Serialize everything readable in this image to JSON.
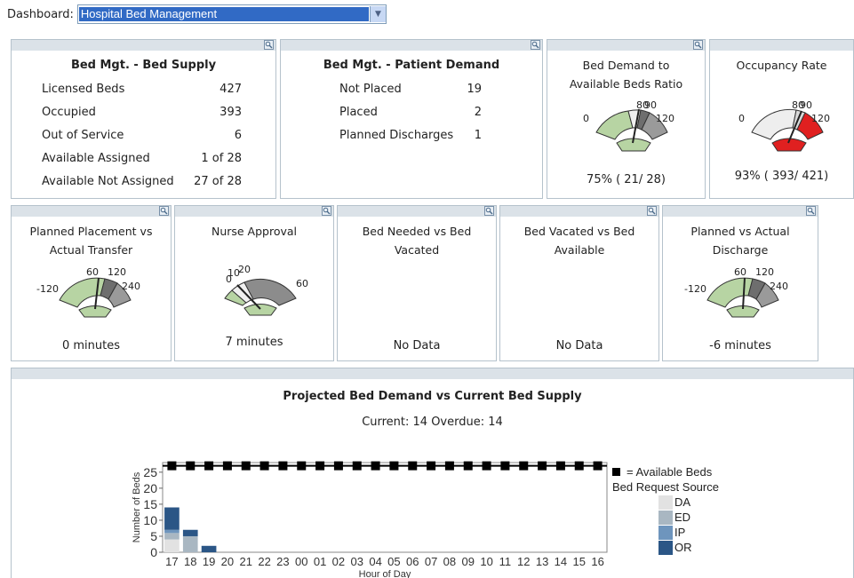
{
  "header": {
    "dashboard_label": "Dashboard:",
    "dashboard_value": "Hospital Bed Management"
  },
  "bed_supply": {
    "title": "Bed Mgt. - Bed Supply",
    "rows": [
      {
        "label": "Licensed Beds",
        "value": "427"
      },
      {
        "label": "Occupied",
        "value": "393"
      },
      {
        "label": "Out of Service",
        "value": "6"
      },
      {
        "label": "Available Assigned",
        "value": "1 of 28"
      },
      {
        "label": "Available Not Assigned",
        "value": "27 of 28"
      }
    ]
  },
  "patient_demand": {
    "title": "Bed Mgt. - Patient Demand",
    "rows": [
      {
        "label": "Not Placed",
        "value": "19"
      },
      {
        "label": "Placed",
        "value": "2"
      },
      {
        "label": "Planned Discharges",
        "value": "1"
      }
    ]
  },
  "gauges": {
    "demand_ratio": {
      "title_line1": "Bed Demand to",
      "title_line2": "Available Beds Ratio",
      "labels": [
        "0",
        "80",
        "90",
        "120"
      ],
      "value": "75% ( 21/ 28)"
    },
    "occupancy": {
      "title_line1": "Occupancy Rate",
      "labels": [
        "0",
        "80",
        "90",
        "120"
      ],
      "value": "93% ( 393/ 421)"
    },
    "placement": {
      "title_line1": "Planned Placement vs",
      "title_line2": "Actual Transfer",
      "labels": [
        "-120",
        "60",
        "120",
        "240"
      ],
      "value": "0 minutes"
    },
    "nurse": {
      "title_line1": "Nurse Approval",
      "labels": [
        "0",
        "10",
        "20",
        "60"
      ],
      "value": "7 minutes"
    },
    "bed_needed": {
      "title_line1": "Bed Needed vs Bed",
      "title_line2": "Vacated",
      "value": "No Data"
    },
    "bed_vacated": {
      "title_line1": "Bed Vacated vs Bed",
      "title_line2": "Available",
      "value": "No Data"
    },
    "discharge": {
      "title_line1": "Planned vs Actual",
      "title_line2": "Discharge",
      "labels": [
        "-120",
        "60",
        "120",
        "240"
      ],
      "value": "-6 minutes"
    }
  },
  "projection": {
    "title": "Projected Bed Demand vs Current Bed Supply",
    "subtitle": "Current: 14 Overdue: 14",
    "legend": {
      "available_label": "= Available Beds",
      "source_title": "Bed Request Source",
      "items": [
        {
          "name": "DA",
          "color": "#e2e2e2"
        },
        {
          "name": "ED",
          "color": "#a9b7c2"
        },
        {
          "name": "IP",
          "color": "#6e95bd"
        },
        {
          "name": "OR",
          "color": "#2b5686"
        }
      ]
    }
  },
  "chart_data": {
    "type": "bar",
    "stacked": true,
    "xlabel": "Hour of Day",
    "ylabel": "Number of Beds",
    "ylim": [
      0,
      28
    ],
    "yticks": [
      0,
      5,
      10,
      15,
      20,
      25
    ],
    "categories": [
      "17",
      "18",
      "19",
      "20",
      "21",
      "22",
      "23",
      "00",
      "01",
      "02",
      "03",
      "04",
      "05",
      "06",
      "07",
      "08",
      "09",
      "10",
      "11",
      "12",
      "13",
      "14",
      "15",
      "16"
    ],
    "series": [
      {
        "name": "DA",
        "color": "#e2e2e2",
        "values": [
          4,
          0,
          0,
          0,
          0,
          0,
          0,
          0,
          0,
          0,
          0,
          0,
          0,
          0,
          0,
          0,
          0,
          0,
          0,
          0,
          0,
          0,
          0,
          0
        ]
      },
      {
        "name": "ED",
        "color": "#a9b7c2",
        "values": [
          2,
          5,
          0,
          0,
          0,
          0,
          0,
          0,
          0,
          0,
          0,
          0,
          0,
          0,
          0,
          0,
          0,
          0,
          0,
          0,
          0,
          0,
          0,
          0
        ]
      },
      {
        "name": "IP",
        "color": "#6e95bd",
        "values": [
          1,
          0,
          0,
          0,
          0,
          0,
          0,
          0,
          0,
          0,
          0,
          0,
          0,
          0,
          0,
          0,
          0,
          0,
          0,
          0,
          0,
          0,
          0,
          0
        ]
      },
      {
        "name": "OR",
        "color": "#2b5686",
        "values": [
          7,
          2,
          2,
          0,
          0,
          0,
          0,
          0,
          0,
          0,
          0,
          0,
          0,
          0,
          0,
          0,
          0,
          0,
          0,
          0,
          0,
          0,
          0,
          0
        ]
      }
    ],
    "available_beds": {
      "name": "Available Beds",
      "values": [
        27,
        27,
        27,
        27,
        27,
        27,
        27,
        27,
        27,
        27,
        27,
        27,
        27,
        27,
        27,
        27,
        27,
        27,
        27,
        27,
        27,
        27,
        27,
        27
      ]
    }
  }
}
